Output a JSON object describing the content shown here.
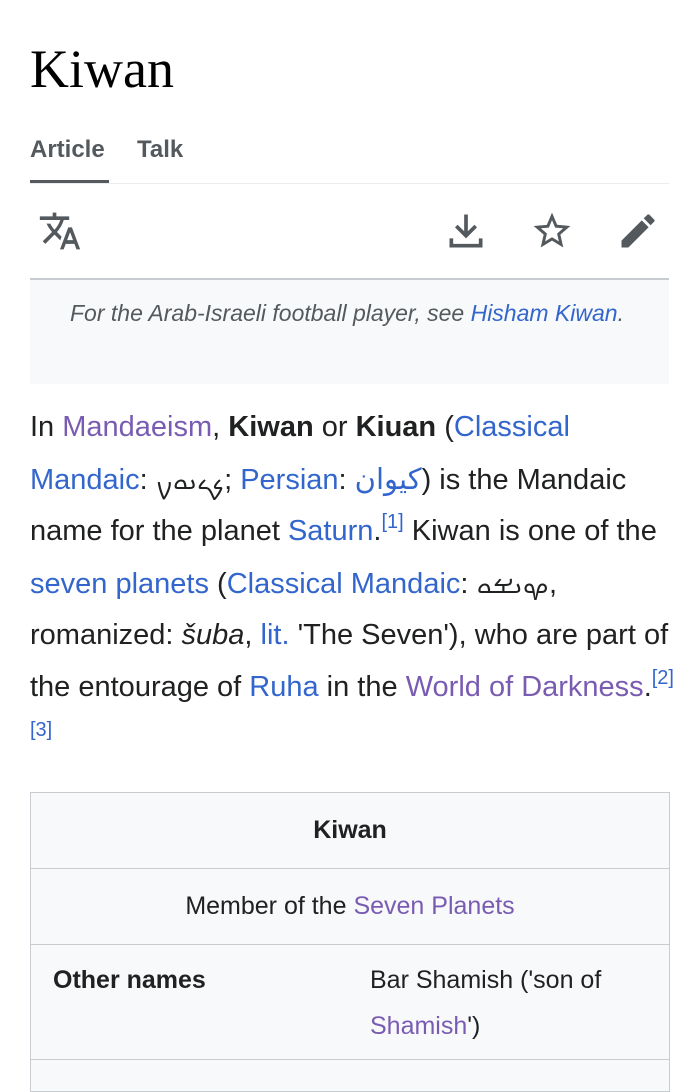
{
  "page": {
    "title": "Kiwan"
  },
  "tabs": [
    {
      "label": "Article"
    },
    {
      "label": "Talk"
    }
  ],
  "toolbar": {
    "icons": [
      "language-icon",
      "download-icon",
      "star-icon",
      "edit-icon"
    ]
  },
  "hatnote": {
    "prefix": "For the Arab-Israeli football player, see ",
    "link": "Hisham Kiwan",
    "suffix": "."
  },
  "lead": {
    "t1": "In ",
    "mandaeism": "Mandaeism",
    "t2": ", ",
    "kiwan": "Kiwan",
    "t3": " or ",
    "kiuan": "Kiuan",
    "t4": " (",
    "classical_mandaic": "Classical Mandaic",
    "t5": ": ",
    "mandaic_script": "ࡊࡉࡅࡀࡍ",
    "t6": "; ",
    "persian": "Persian",
    "t7": ": ",
    "persian_script": "کیوان",
    "t8": ") is the Mandaic name for the planet ",
    "saturn": "Saturn",
    "t9": ".",
    "ref1": "[1]",
    "t10": " Kiwan is one of the ",
    "seven_planets": "seven planets",
    "t11": " (",
    "classical_mandaic_2": "Classical Mandaic",
    "t12": ": ",
    "mandaic_script_2": "ࡔࡅࡁࡀ",
    "t13": ", romanized: ",
    "romanized": "šuba",
    "t14": ", ",
    "lit": "lit.",
    "t15": " 'The Seven'), who are part of the entourage of ",
    "ruha": "Ruha",
    "t16": " in the ",
    "world_of_darkness": "World of Darkness",
    "t17": ".",
    "ref2": "[2]",
    "ref3": "[3]"
  },
  "infobox": {
    "title": "Kiwan",
    "subtitle_prefix": "Member of the ",
    "subtitle_link": "Seven Planets",
    "rows": [
      {
        "label": "Other names",
        "value_prefix": "Bar Shamish ('son of ",
        "value_link": "Shamish",
        "value_suffix": "')"
      }
    ]
  },
  "colors": {
    "link": "#3366cc",
    "visited_link": "#795cb2",
    "text": "#202122",
    "muted": "#54595d"
  }
}
